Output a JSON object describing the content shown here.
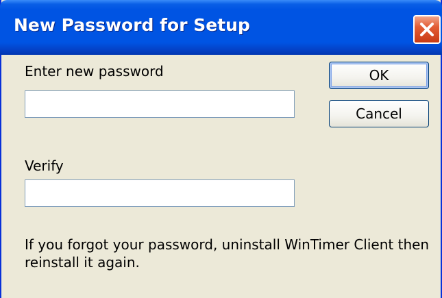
{
  "dialog": {
    "title": "New Password for Setup",
    "close_icon": "close-icon",
    "new_password_label": "Enter new password",
    "new_password_value": "",
    "verify_label": "Verify",
    "verify_value": "",
    "ok_label": "OK",
    "cancel_label": "Cancel",
    "help_text": "If you forgot your password, uninstall WinTimer Client then reinstall it again.",
    "colors": {
      "titlebar": "#0054e3",
      "close_button": "#e35d34",
      "background": "#ece9d8"
    }
  }
}
